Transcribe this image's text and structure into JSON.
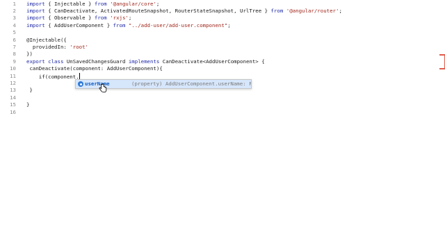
{
  "editor": {
    "lines": [
      {
        "n": "1",
        "tokens": [
          {
            "t": "import",
            "c": "kw"
          },
          {
            "t": " { Injectable } ",
            "c": ""
          },
          {
            "t": "from",
            "c": "kw"
          },
          {
            "t": " ",
            "c": ""
          },
          {
            "t": "'@angular/core'",
            "c": "str"
          },
          {
            "t": ";",
            "c": ""
          }
        ]
      },
      {
        "n": "2",
        "tokens": [
          {
            "t": "import",
            "c": "kw"
          },
          {
            "t": " { CanDeactivate, ActivatedRouteSnapshot, RouterStateSnapshot, UrlTree } ",
            "c": ""
          },
          {
            "t": "from",
            "c": "kw"
          },
          {
            "t": " ",
            "c": ""
          },
          {
            "t": "'@angular/router'",
            "c": "str"
          },
          {
            "t": ";",
            "c": ""
          }
        ]
      },
      {
        "n": "3",
        "tokens": [
          {
            "t": "import",
            "c": "kw"
          },
          {
            "t": " { Observable } ",
            "c": ""
          },
          {
            "t": "from",
            "c": "kw"
          },
          {
            "t": " ",
            "c": ""
          },
          {
            "t": "'rxjs'",
            "c": "str"
          },
          {
            "t": ";",
            "c": ""
          }
        ]
      },
      {
        "n": "4",
        "tokens": [
          {
            "t": "import",
            "c": "kw"
          },
          {
            "t": " { AddUserComponent } ",
            "c": ""
          },
          {
            "t": "from",
            "c": "kw"
          },
          {
            "t": " ",
            "c": ""
          },
          {
            "t": "\"../add-user/add-user.component\"",
            "c": "str"
          },
          {
            "t": ";",
            "c": ""
          }
        ]
      },
      {
        "n": "5",
        "tokens": []
      },
      {
        "n": "6",
        "tokens": [
          {
            "t": "@Injectable({",
            "c": ""
          }
        ]
      },
      {
        "n": "7",
        "tokens": [
          {
            "t": "  providedIn: ",
            "c": ""
          },
          {
            "t": "'root'",
            "c": "str"
          }
        ]
      },
      {
        "n": "8",
        "tokens": [
          {
            "t": "})",
            "c": ""
          }
        ]
      },
      {
        "n": "9",
        "tokens": [
          {
            "t": "export",
            "c": "kw"
          },
          {
            "t": " ",
            "c": ""
          },
          {
            "t": "class",
            "c": "kw"
          },
          {
            "t": " UnSavedChangesGuard ",
            "c": ""
          },
          {
            "t": "implements",
            "c": "kw"
          },
          {
            "t": " CanDeactivate<AddUserComponent> {",
            "c": ""
          }
        ]
      },
      {
        "n": "10",
        "tokens": [
          {
            "t": " canDeactivate(component: AddUserComponent){",
            "c": ""
          }
        ]
      },
      {
        "n": "11",
        "tokens": [
          {
            "t": "    if(component.",
            "c": ""
          }
        ]
      },
      {
        "n": "12",
        "tokens": []
      },
      {
        "n": "13",
        "tokens": [
          {
            "t": " }",
            "c": ""
          }
        ]
      },
      {
        "n": "14",
        "tokens": []
      },
      {
        "n": "15",
        "tokens": [
          {
            "t": "}",
            "c": ""
          }
        ]
      },
      {
        "n": "16",
        "tokens": []
      }
    ]
  },
  "suggest": {
    "icon": "property-icon",
    "label": "userName",
    "detail": "(property) AddUserComponent.userName: FormCont…"
  },
  "colors": {
    "keyword": "#1f2aa8",
    "string": "#a0271c",
    "line_number": "#8a8a8a",
    "suggest_highlight": "#d6e6fb",
    "suggest_icon": "#2f7ad6",
    "marker": "#e05a4a"
  }
}
